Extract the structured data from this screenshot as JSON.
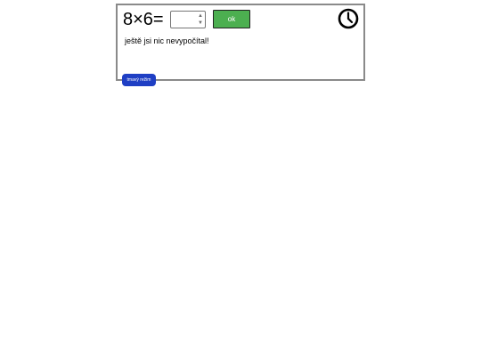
{
  "quiz": {
    "equation": "8×6=",
    "answer_value": "",
    "ok_label": "ok",
    "status_message": "ještě jsi nic nevypočítal!"
  },
  "controls": {
    "dark_mode_label": "tmavý režim"
  },
  "icons": {
    "timer": "clock-icon",
    "spinner_up": "chevron-up-icon",
    "spinner_down": "chevron-down-icon"
  },
  "colors": {
    "panel_border": "#8a8a8a",
    "ok_button": "#4caf50",
    "dark_mode_button": "#1f3fc4"
  }
}
